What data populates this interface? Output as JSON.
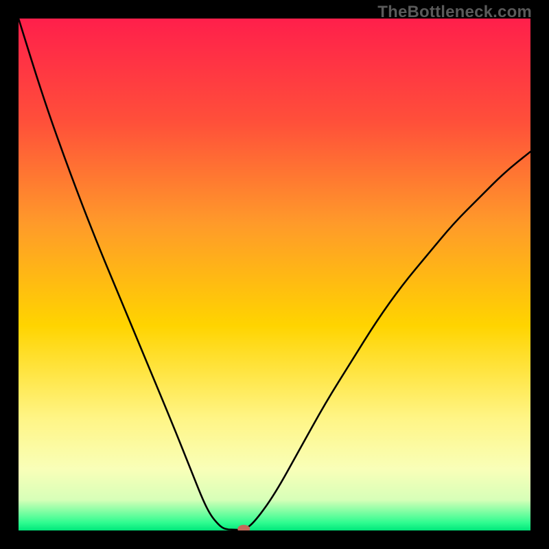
{
  "watermark": "TheBottleneck.com",
  "chart_data": {
    "type": "line",
    "title": "",
    "xlabel": "",
    "ylabel": "",
    "xlim": [
      0,
      100
    ],
    "ylim": [
      0,
      100
    ],
    "grid": false,
    "legend": false,
    "gradient_stops": [
      {
        "offset": 0.0,
        "color": "#ff1f4b"
      },
      {
        "offset": 0.2,
        "color": "#ff4f3a"
      },
      {
        "offset": 0.4,
        "color": "#ff9a2a"
      },
      {
        "offset": 0.6,
        "color": "#ffd400"
      },
      {
        "offset": 0.78,
        "color": "#fff585"
      },
      {
        "offset": 0.88,
        "color": "#f9ffb8"
      },
      {
        "offset": 0.94,
        "color": "#d7ffb8"
      },
      {
        "offset": 0.985,
        "color": "#2efc90"
      },
      {
        "offset": 1.0,
        "color": "#00e67a"
      }
    ],
    "series": [
      {
        "name": "left-branch",
        "x": [
          0,
          5,
          10,
          15,
          20,
          25,
          30,
          34,
          36,
          37.5,
          39,
          40,
          41
        ],
        "values": [
          100,
          84,
          70,
          57,
          45,
          33,
          21,
          11,
          6,
          3,
          1.2,
          0.4,
          0.2
        ]
      },
      {
        "name": "floor",
        "x": [
          41,
          44
        ],
        "values": [
          0.2,
          0.1
        ]
      },
      {
        "name": "right-branch",
        "x": [
          44,
          46,
          50,
          55,
          60,
          65,
          70,
          75,
          80,
          85,
          90,
          95,
          100
        ],
        "values": [
          0.1,
          1.5,
          7,
          16,
          25,
          33,
          41,
          48,
          54,
          60,
          65,
          70,
          74
        ]
      }
    ],
    "marker": {
      "x": 44,
      "y": 0.3,
      "color": "#c66a5a",
      "rx": 9,
      "ry": 6
    }
  }
}
